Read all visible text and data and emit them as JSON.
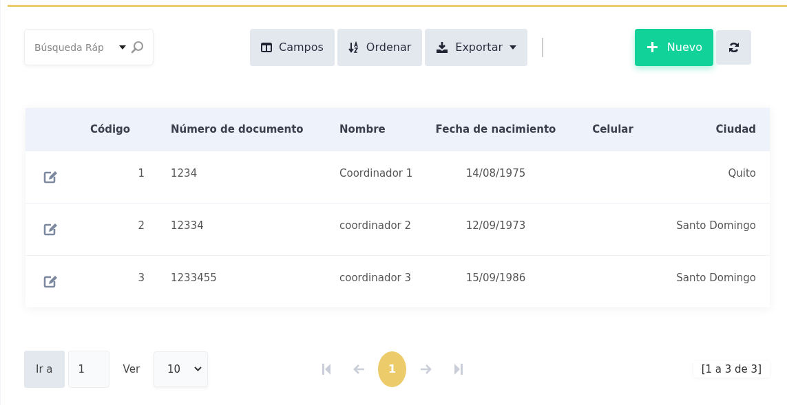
{
  "toolbar": {
    "search": {
      "placeholder": "Búsqueda Ráp"
    },
    "buttons": [
      {
        "kind": "columns",
        "label": "Campos",
        "dropdown": false
      },
      {
        "kind": "sort",
        "label": "Ordenar",
        "dropdown": false
      },
      {
        "kind": "export",
        "label": "Exportar",
        "dropdown": true
      }
    ],
    "new_button": {
      "label": "Nuevo"
    }
  },
  "table": {
    "columns": [
      "Código",
      "Número de documento",
      "Nombre",
      "Fecha de nacimiento",
      "Celular",
      "Ciudad"
    ],
    "rows": [
      [
        "1",
        "1234",
        "Coordinador 1",
        "14/08/1975",
        "",
        "Quito"
      ],
      [
        "2",
        "12334",
        "coordinador 2",
        "12/09/1973",
        "",
        "Santo Domingo"
      ],
      [
        "3",
        "1233455",
        "coordinador 3",
        "15/09/1986",
        "",
        "Santo Domingo"
      ]
    ]
  },
  "pagination": {
    "goto_label": "Ir a",
    "goto_value": "1",
    "view_label": "Ver",
    "page_size": "10",
    "nav": [
      {
        "kind": "first",
        "disabled": true
      },
      {
        "kind": "prev",
        "disabled": true
      },
      {
        "kind": "page",
        "label": "1",
        "selected": true
      },
      {
        "kind": "next",
        "disabled": true
      },
      {
        "kind": "last",
        "disabled": true
      }
    ],
    "summary": "[1 a 3 de 3]"
  }
}
